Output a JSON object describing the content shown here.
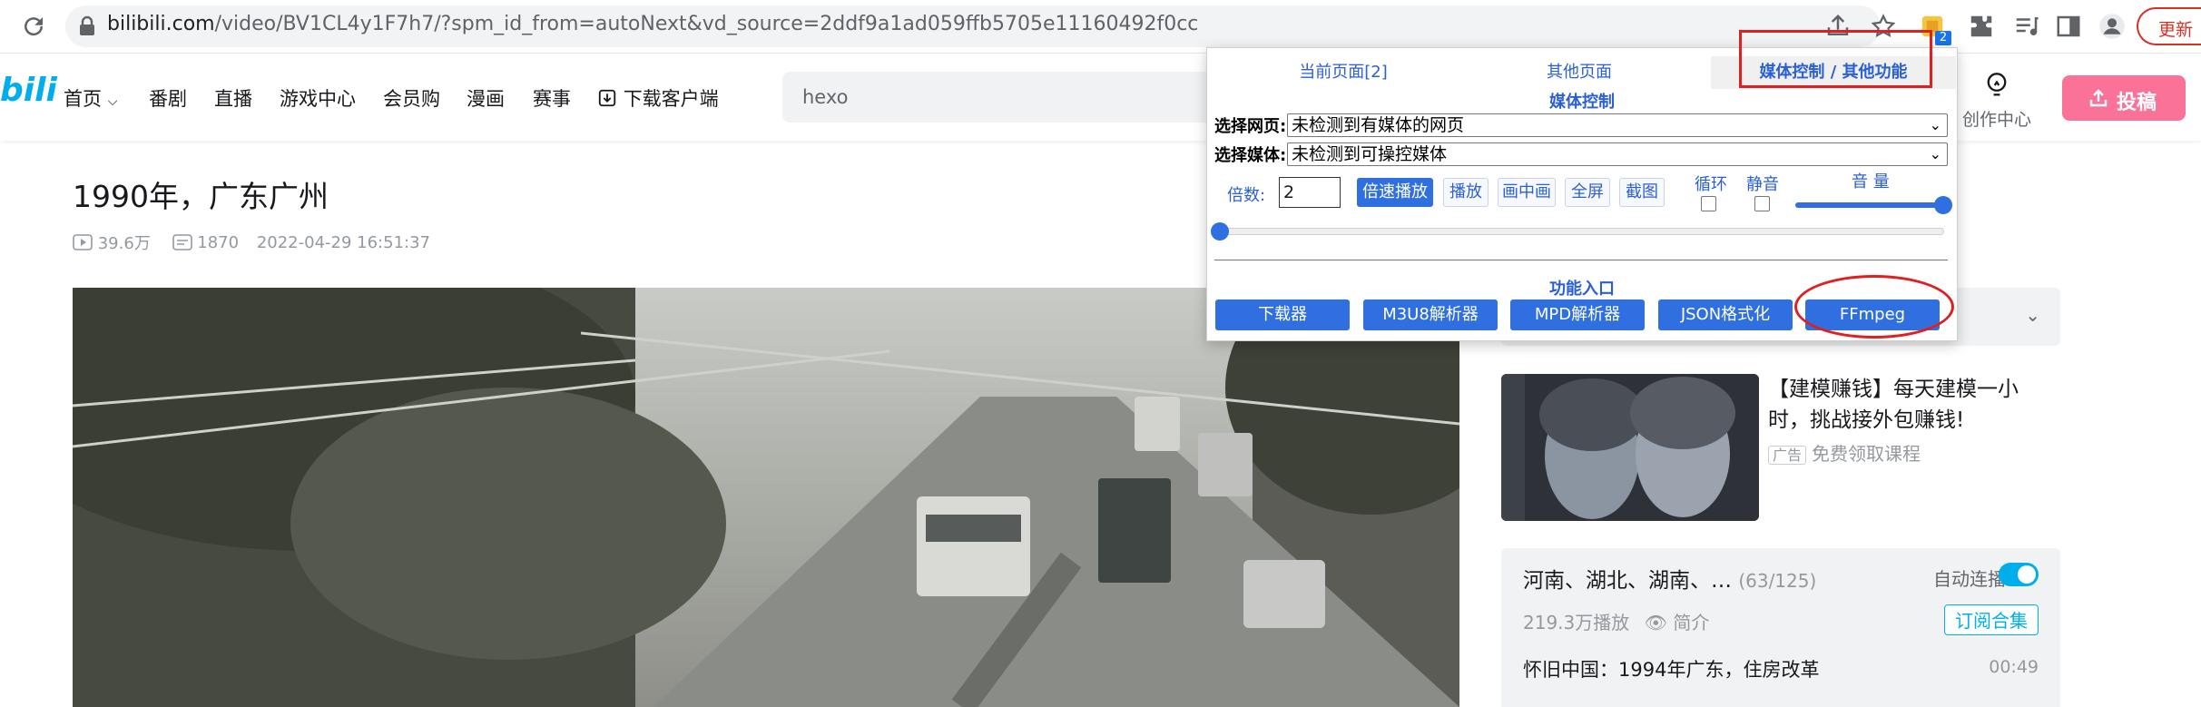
{
  "browser": {
    "url_host": "bilibili.com",
    "url_path": "/video/BV1CL4y1F7h7/?spm_id_from=autoNext&vd_source=2ddf9a1ad059ffb5705e11160492f0cc",
    "extension_badge": "2",
    "update_label": "更新"
  },
  "header": {
    "logo": "bili",
    "nav": [
      "首页",
      "番剧",
      "直播",
      "游戏中心",
      "会员购",
      "漫画",
      "赛事",
      "下载客户端"
    ],
    "search_value": "hexo",
    "creator_label": "创作中心",
    "post_label": "投稿"
  },
  "video": {
    "title": "1990年，广东广州",
    "views": "39.6万",
    "danmaku": "1870",
    "date": "2022-04-29 16:51:37"
  },
  "ad": {
    "title": "【建模赚钱】每天建模一小时，挑战接外包赚钱!",
    "tag": "广告",
    "subtitle": "免费领取课程"
  },
  "playlist": {
    "title": "河南、湖北、湖南、…",
    "count": "(63/125)",
    "autoplay_label": "自动连播",
    "plays": "219.3万播放",
    "intro_label": "简介",
    "subscribe_label": "订阅合集",
    "items": [
      {
        "title": "怀旧中国：1994年广东，住房改革",
        "duration": "00:49"
      }
    ]
  },
  "popup": {
    "tabs": [
      "当前页面[2]",
      "其他页面",
      "媒体控制 / 其他功能"
    ],
    "media_section_title": "媒体控制",
    "select_page_label": "选择网页:",
    "select_page_value": "未检测到有媒体的网页",
    "select_media_label": "选择媒体:",
    "select_media_value": "未检测到可操控媒体",
    "speed_label": "倍数:",
    "speed_value": "2",
    "buttons": [
      "倍速播放",
      "播放",
      "画中画",
      "全屏",
      "截图"
    ],
    "loop_label": "循环",
    "mute_label": "静音",
    "volume_label": "音 量",
    "volume_level": 1.0,
    "progress_level": 0.0,
    "features_title": "功能入口",
    "feature_buttons": [
      "下载器",
      "M3U8解析器",
      "MPD解析器",
      "JSON格式化",
      "FFmpeg"
    ]
  },
  "colors": {
    "bili_blue": "#00aeec",
    "bili_pink": "#fb7299",
    "popup_blue": "#2f6fdf",
    "annotation_red": "#e02020"
  }
}
